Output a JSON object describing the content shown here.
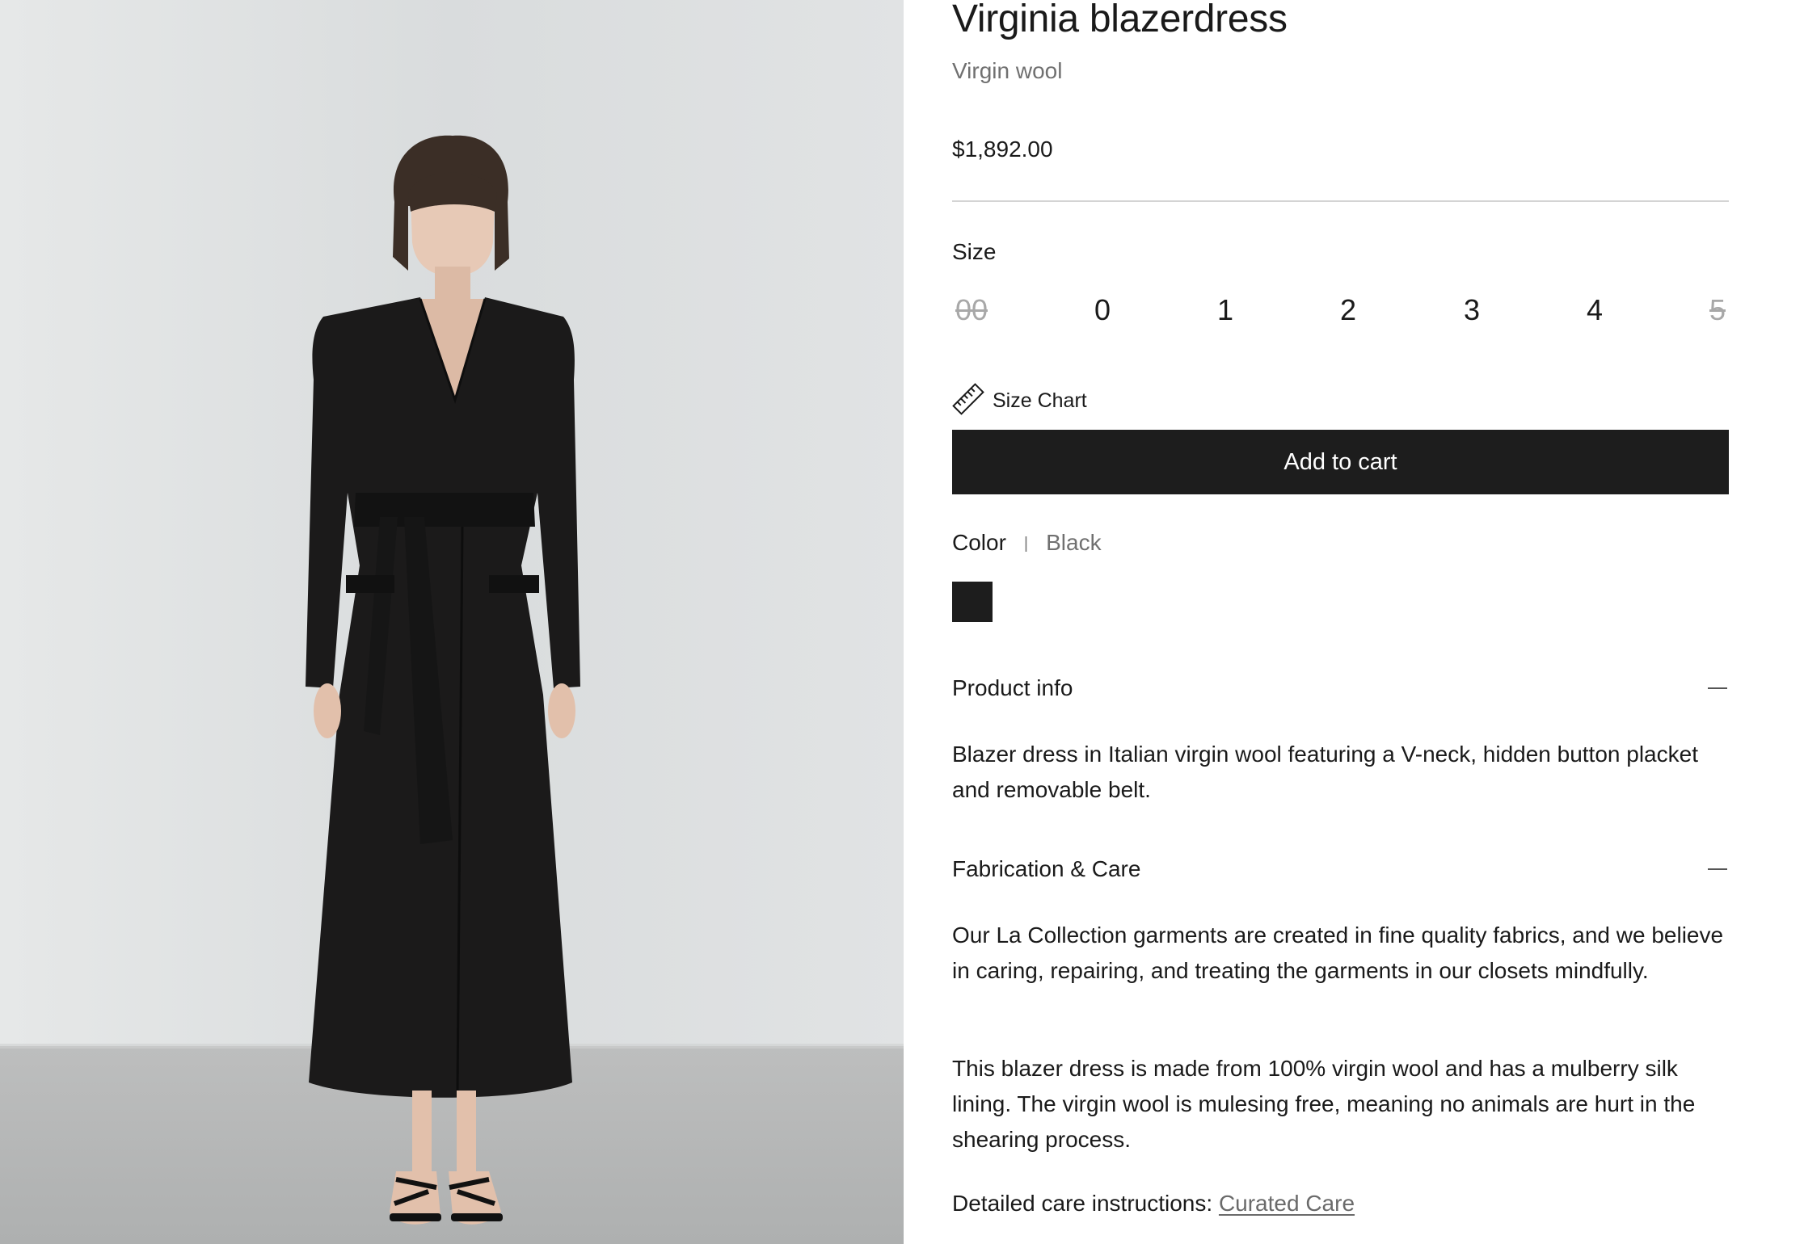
{
  "product": {
    "title": "Virginia blazerdress",
    "subtitle": "Virgin wool",
    "price": "$1,892.00",
    "image_alt": "Model wearing the Virginia blazerdress in black with tie belt and black strappy sandals"
  },
  "size": {
    "label": "Size",
    "options": [
      {
        "label": "00",
        "available": false
      },
      {
        "label": "0",
        "available": true
      },
      {
        "label": "1",
        "available": true
      },
      {
        "label": "2",
        "available": true
      },
      {
        "label": "3",
        "available": true
      },
      {
        "label": "4",
        "available": true
      },
      {
        "label": "5",
        "available": false
      }
    ],
    "chart_label": "Size Chart",
    "chart_icon": "ruler-icon"
  },
  "cart": {
    "add_label": "Add to cart"
  },
  "color": {
    "label": "Color",
    "separator": "|",
    "selected": "Black",
    "swatch_color": "#1d1d1d"
  },
  "product_info": {
    "heading": "Product info",
    "text": "Blazer dress in Italian virgin wool featuring a V-neck, hidden button placket and removable belt."
  },
  "fabrication": {
    "heading": "Fabrication & Care",
    "paragraph_1": "Our La Collection garments are created in fine quality fabrics, and we believe in caring, repairing, and treating the garments in our closets mindfully.",
    "paragraph_2": "This blazer dress is made from 100% virgin wool and has a mulberry silk lining. The virgin wool is mulesing free, meaning no animals are hurt in the shearing process.",
    "care_prefix": "Detailed care instructions: ",
    "care_link": "Curated Care"
  },
  "colors": {
    "button_bg": "#1d1d1d",
    "muted_text": "#707070",
    "out_of_stock": "#a8a8a8"
  }
}
